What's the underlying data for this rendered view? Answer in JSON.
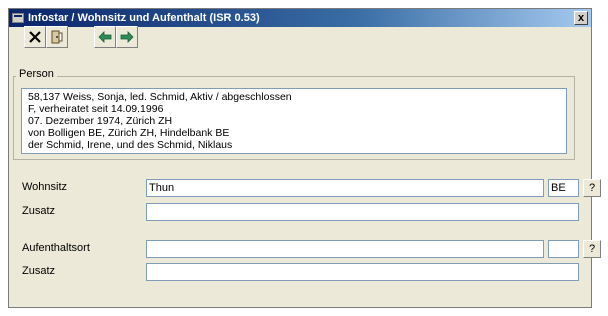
{
  "window": {
    "title": "Infostar / Wohnsitz und Aufenthalt (ISR 0.53)",
    "close_glyph": "x"
  },
  "toolbar": {
    "delete_icon": "close-x-icon",
    "exit_icon": "exit-door-icon",
    "prev_icon": "arrow-left-icon",
    "next_icon": "arrow-right-icon"
  },
  "person": {
    "group_label": "Person",
    "lines": [
      "58,137  Weiss, Sonja, led. Schmid, Aktiv / abgeschlossen",
      "F, verheiratet seit 14.09.1996",
      "07. Dezember 1974, Zürich ZH",
      "von Bolligen BE, Zürich ZH, Hindelbank BE",
      "der Schmid, Irene, und des Schmid, Niklaus"
    ]
  },
  "wohnsitz": {
    "label": "Wohnsitz",
    "value": "Thun",
    "canton": "BE",
    "help": "?"
  },
  "zusatz1": {
    "label": "Zusatz",
    "value": ""
  },
  "aufenthalt": {
    "label": "Aufenthaltsort",
    "value": "",
    "canton": "",
    "help": "?"
  },
  "zusatz2": {
    "label": "Zusatz",
    "value": ""
  },
  "colors": {
    "title_start": "#0a246a",
    "title_end": "#a6caf0",
    "arrow_green": "#2e8b57",
    "window_bg": "#ece9d8"
  }
}
